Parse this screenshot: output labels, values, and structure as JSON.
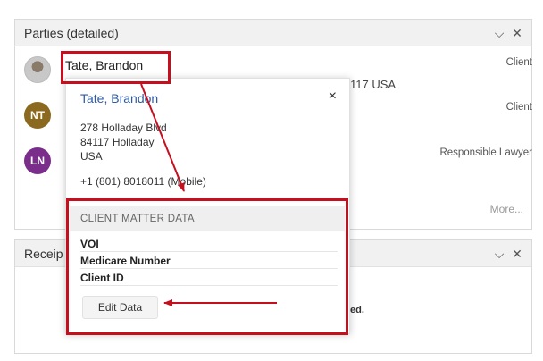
{
  "parties_panel": {
    "title": "Parties (detailed)",
    "parties": [
      {
        "name": "Tate, Brandon",
        "role": "Client",
        "address_partial": "117 USA"
      },
      {
        "initials": "NT",
        "role": "Client",
        "avatar_color": "#8b6a1f"
      },
      {
        "initials": "LN",
        "role": "Responsible Lawyer",
        "avatar_color": "#7b2d8b"
      }
    ],
    "more_label": "More..."
  },
  "receipts_panel": {
    "title": "Receip",
    "partial_text": "ed."
  },
  "popover": {
    "name": "Tate, Brandon",
    "close_icon": "×",
    "address_line1": "278 Holladay Blvd",
    "address_line2": "84117 Holladay",
    "address_line3": "USA",
    "phone": "+1 (801) 8018011 (Mobile)",
    "section_title": "CLIENT MATTER DATA",
    "fields": [
      "VOI",
      "Medicare Number",
      "Client ID"
    ],
    "edit_button_label": "Edit Data"
  },
  "icons": {
    "collapse": "⌵",
    "close": "✕"
  },
  "colors": {
    "annotation_red": "#c50f1f",
    "link_blue": "#2d5aa6",
    "header_bg": "#f1f1f1"
  }
}
